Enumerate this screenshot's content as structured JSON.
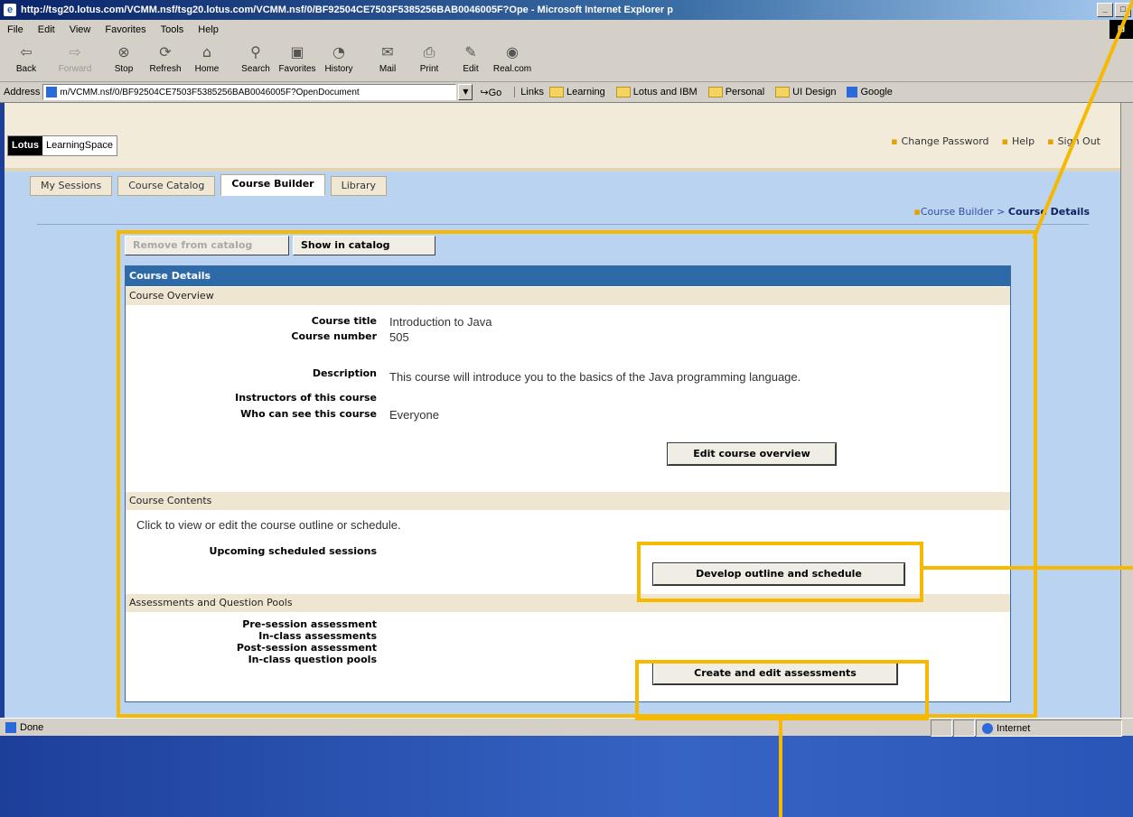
{
  "window": {
    "title": "http://tsg20.lotus.com/VCMM.nsf/tsg20.lotus.com/VCMM.nsf/0/BF92504CE7503F5385256BAB0046005F?Ope - Microsoft Internet Explorer p",
    "controls": [
      "_",
      "□"
    ]
  },
  "menu": [
    "File",
    "Edit",
    "View",
    "Favorites",
    "Tools",
    "Help"
  ],
  "toolbar": {
    "back": "Back",
    "forward": "Forward",
    "stop": "Stop",
    "refresh": "Refresh",
    "home": "Home",
    "search": "Search",
    "favorites": "Favorites",
    "history": "History",
    "mail": "Mail",
    "print": "Print",
    "edit": "Edit",
    "realcom": "Real.com"
  },
  "address": {
    "label": "Address",
    "url": "m/VCMM.nsf/0/BF92504CE7503F5385256BAB0046005F?OpenDocument",
    "go": "Go",
    "links_label": "Links",
    "links": [
      "Learning",
      "Lotus and IBM",
      "Personal",
      "UI Design",
      "Google"
    ]
  },
  "app": {
    "logo_brand": "Lotus",
    "logo_product": "LearningSpace",
    "util_links": [
      "Change Password",
      "Help",
      "Sign Out"
    ],
    "tabs": [
      "My Sessions",
      "Course Catalog",
      "Course Builder",
      "Library"
    ],
    "breadcrumb_parent": "Course Builder",
    "breadcrumb_sep": " > ",
    "breadcrumb_current": "Course Details"
  },
  "catalog_buttons": {
    "remove": "Remove from catalog",
    "show": "Show in catalog"
  },
  "panel": {
    "title": "Course Details",
    "overview": {
      "header": "Course Overview",
      "course_title_label": "Course title",
      "course_title_value": "Introduction to Java",
      "course_number_label": "Course number",
      "course_number_value": "505",
      "description_label": "Description",
      "description_value": "This course will introduce you to the basics of the Java programming language.",
      "instructors_label": "Instructors of this course",
      "visibility_label": "Who can see this course",
      "visibility_value": "Everyone",
      "edit_button": "Edit course overview"
    },
    "contents": {
      "header": "Course Contents",
      "help_text": "Click to view or edit the course outline or schedule.",
      "sessions_label": "Upcoming scheduled sessions",
      "develop_button": "Develop outline and schedule"
    },
    "assessments": {
      "header": "Assessments and Question Pools",
      "pre_label": "Pre-session assessment",
      "inclass_label": "In-class assessments",
      "post_label": "Post-session assessment",
      "pools_label": "In-class question pools",
      "create_button": "Create and edit assessments"
    }
  },
  "status": {
    "text": "Done",
    "zone": "Internet"
  },
  "colors": {
    "callout": "#f7b800",
    "panel_header": "#2e6aa8",
    "section_header": "#efe6d2"
  }
}
